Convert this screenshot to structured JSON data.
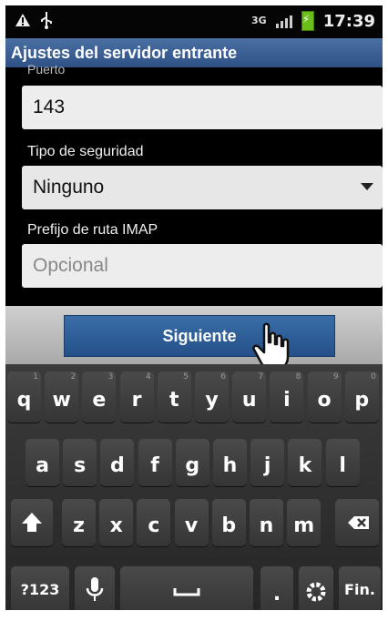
{
  "status_bar": {
    "network": "3G",
    "time": "17:39",
    "left_icons": [
      "warning-icon",
      "usb-icon"
    ],
    "battery_color": "#6bbf1a"
  },
  "title_bar": {
    "title": "Ajustes del servidor entrante"
  },
  "form": {
    "port_label": "Puerto",
    "port_value": "143",
    "security_label": "Tipo de seguridad",
    "security_value": "Ninguno",
    "imap_prefix_label": "Prefijo de ruta IMAP",
    "imap_prefix_placeholder": "Opcional"
  },
  "button_bar": {
    "next_label": "Siguiente",
    "accent": "#2e5a94"
  },
  "keyboard": {
    "row1": [
      {
        "ch": "q",
        "num": "1"
      },
      {
        "ch": "w",
        "num": "2"
      },
      {
        "ch": "e",
        "num": "3"
      },
      {
        "ch": "r",
        "num": "4"
      },
      {
        "ch": "t",
        "num": "5"
      },
      {
        "ch": "y",
        "num": "6"
      },
      {
        "ch": "u",
        "num": "7"
      },
      {
        "ch": "i",
        "num": "8"
      },
      {
        "ch": "o",
        "num": "9"
      },
      {
        "ch": "p",
        "num": "0"
      }
    ],
    "row2": [
      "a",
      "s",
      "d",
      "f",
      "g",
      "h",
      "j",
      "k",
      "l"
    ],
    "row3": [
      "z",
      "x",
      "c",
      "v",
      "b",
      "n",
      "m"
    ],
    "symbols_label": "?123",
    "done_label": "Fin.",
    "period_label": ".",
    "shift_icon": "shift-arrow-icon",
    "backspace_icon": "backspace-icon",
    "mic_icon": "microphone-icon",
    "space_icon": "space-bar-icon",
    "settings_icon": "gear-icon"
  }
}
